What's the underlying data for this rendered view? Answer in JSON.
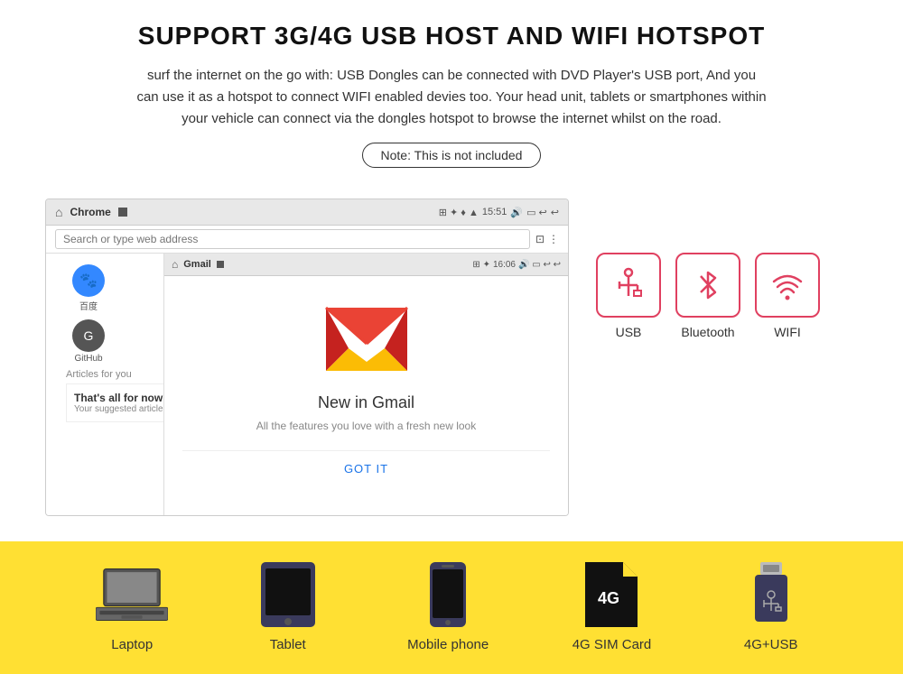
{
  "page": {
    "title": "SUPPORT 3G/4G USB HOST AND WIFI HOTSPOT",
    "subtitle": "surf the internet on the go with: USB Dongles can be connected with DVD Player's USB port, And you can use it as a hotspot to connect WIFI enabled devies too. Your head unit, tablets or smartphones within your vehicle can connect via the dongles hotspot to browse the internet whilst on the road.",
    "note": "Note: This is not included"
  },
  "browser": {
    "chrome_label": "Chrome",
    "chrome_time": "15:51",
    "address_placeholder": "Search or type web address",
    "app1_label": "百度",
    "app2_label": "GitHub",
    "articles_label": "Articles for you",
    "suggestion_title": "That's all for now",
    "suggestion_sub": "Your suggested articles"
  },
  "gmail": {
    "label": "Gmail",
    "time": "16:06",
    "new_title": "New in Gmail",
    "new_sub": "All the features you love with a fresh new look",
    "got_it": "GOT IT"
  },
  "connectivity": {
    "items": [
      {
        "label": "USB",
        "icon": "usb"
      },
      {
        "label": "Bluetooth",
        "icon": "bluetooth"
      },
      {
        "label": "WIFI",
        "icon": "wifi"
      }
    ]
  },
  "devices": [
    {
      "label": "Laptop",
      "type": "laptop"
    },
    {
      "label": "Tablet",
      "type": "tablet"
    },
    {
      "label": "Mobile phone",
      "type": "phone"
    },
    {
      "label": "4G SIM Card",
      "type": "simcard"
    },
    {
      "label": "4G+USB",
      "type": "usb"
    }
  ],
  "colors": {
    "accent": "#e04060",
    "yellow": "#FFE033",
    "title": "#111111",
    "text": "#333333"
  }
}
